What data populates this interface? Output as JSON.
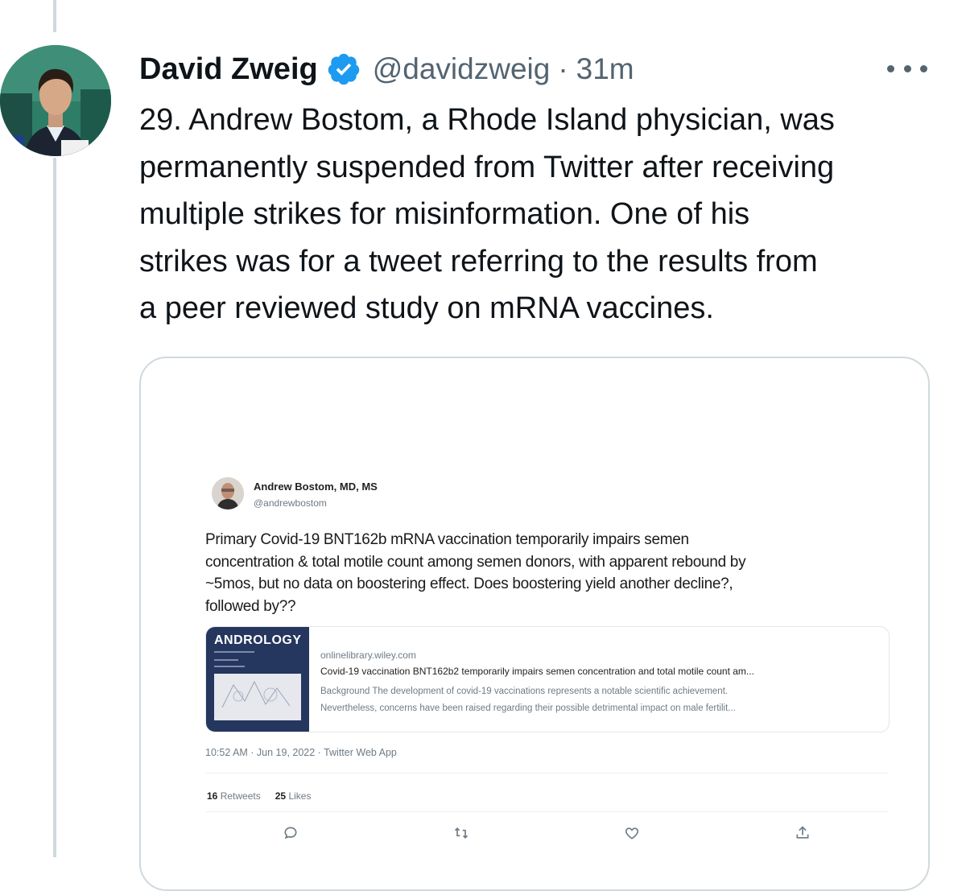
{
  "tweet": {
    "display_name": "David Zweig",
    "handle": "@davidzweig",
    "separator": "·",
    "time": "31m",
    "text": "29. Andrew Bostom, a Rhode Island physician, was\npermanently suspended from Twitter after receiving\nmultiple strikes for misinformation. One of his\nstrikes was for a tweet referring to the results from\na peer reviewed study on mRNA vaccines.",
    "avatar_icon": "profile-photo",
    "verified_icon": "verified-badge-icon",
    "accent_color": "#1d9bf0"
  },
  "embedded": {
    "name": "Andrew Bostom, MD, MS",
    "handle": "@andrewbostom",
    "text": "Primary Covid-19 BNT162b mRNA vaccination temporarily impairs semen\nconcentration & total motile count among semen donors, with apparent rebound by\n~5mos, but no data on boostering effect. Does boostering yield another decline?,\nfollowed by??",
    "link": {
      "journal": "ANDROLOGY",
      "domain": "onlinelibrary.wiley.com",
      "title": "Covid-19 vaccination BNT162b2 temporarily impairs semen concentration and total motile count am...",
      "description": "Background The development of covid-19 vaccinations represents a notable scientific achievement.\nNevertheless, concerns have been raised regarding their possible detrimental impact on male fertilit..."
    },
    "meta": "10:52 AM · Jun 19, 2022 · Twitter Web App",
    "stats": {
      "retweets_count": "16",
      "retweets_label": "Retweets",
      "likes_count": "25",
      "likes_label": "Likes"
    }
  }
}
